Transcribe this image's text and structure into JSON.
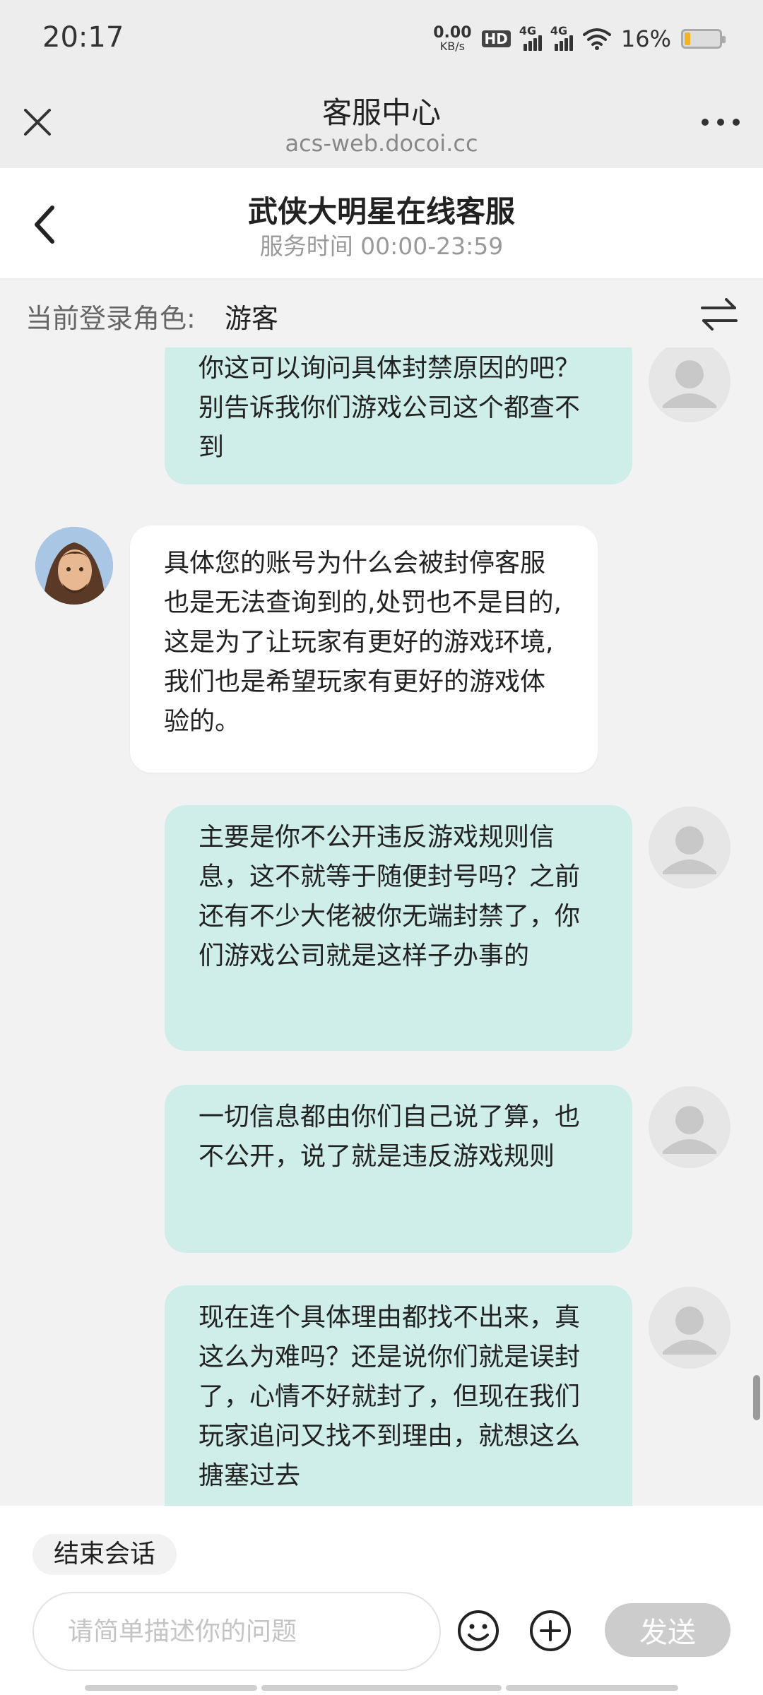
{
  "status_bar": {
    "time": "20:17",
    "net_speed_value": "0.00",
    "net_speed_unit": "KB/s",
    "hd_badge": "HD",
    "signal1_label": "4G",
    "signal2_label": "4G",
    "battery_percent": "16%",
    "battery_level": 0.16,
    "battery_color": "#f0b323"
  },
  "browser": {
    "title": "客服中心",
    "url": "acs-web.docoi.cc",
    "close_icon": "close-icon",
    "more_icon": "more-icon"
  },
  "chat_header": {
    "title": "武侠大明星在线客服",
    "subtitle": "服务时间 00:00-23:59",
    "back_icon": "chevron-left-icon"
  },
  "role_bar": {
    "label": "当前登录角色:",
    "value": "游客",
    "switch_icon": "switch-arrows-icon"
  },
  "messages": [
    {
      "sender": "user",
      "text": "你这可以询问具体封禁原因的吧？别告诉我你们游戏公司这个都查不到"
    },
    {
      "sender": "agent",
      "text": "具体您的账号为什么会被封停客服也是无法查询到的,处罚也不是目的,这是为了让玩家有更好的游戏环境,我们也是希望玩家有更好的游戏体验的。"
    },
    {
      "sender": "user",
      "text": "主要是你不公开违反游戏规则信息，这不就等于随便封号吗？之前还有不少大佬被你无端封禁了，你们游戏公司就是这样子办事的"
    },
    {
      "sender": "user",
      "text": "一切信息都由你们自己说了算，也不公开，说了就是违反游戏规则"
    },
    {
      "sender": "user",
      "text": "现在连个具体理由都找不出来，真这么为难吗？还是说你们就是误封了，心情不好就封了，但现在我们玩家追问又找不到理由，就想这么搪塞过去"
    }
  ],
  "bottom": {
    "end_session_label": "结束会话",
    "input_placeholder": "请简单描述你的问题",
    "emoji_icon": "emoji-icon",
    "plus_icon": "plus-icon",
    "send_label": "发送"
  },
  "colors": {
    "user_bubble": "#cfeeea",
    "agent_bubble": "#ffffff",
    "background": "#f2f2f2",
    "send_disabled": "#cccccc"
  }
}
